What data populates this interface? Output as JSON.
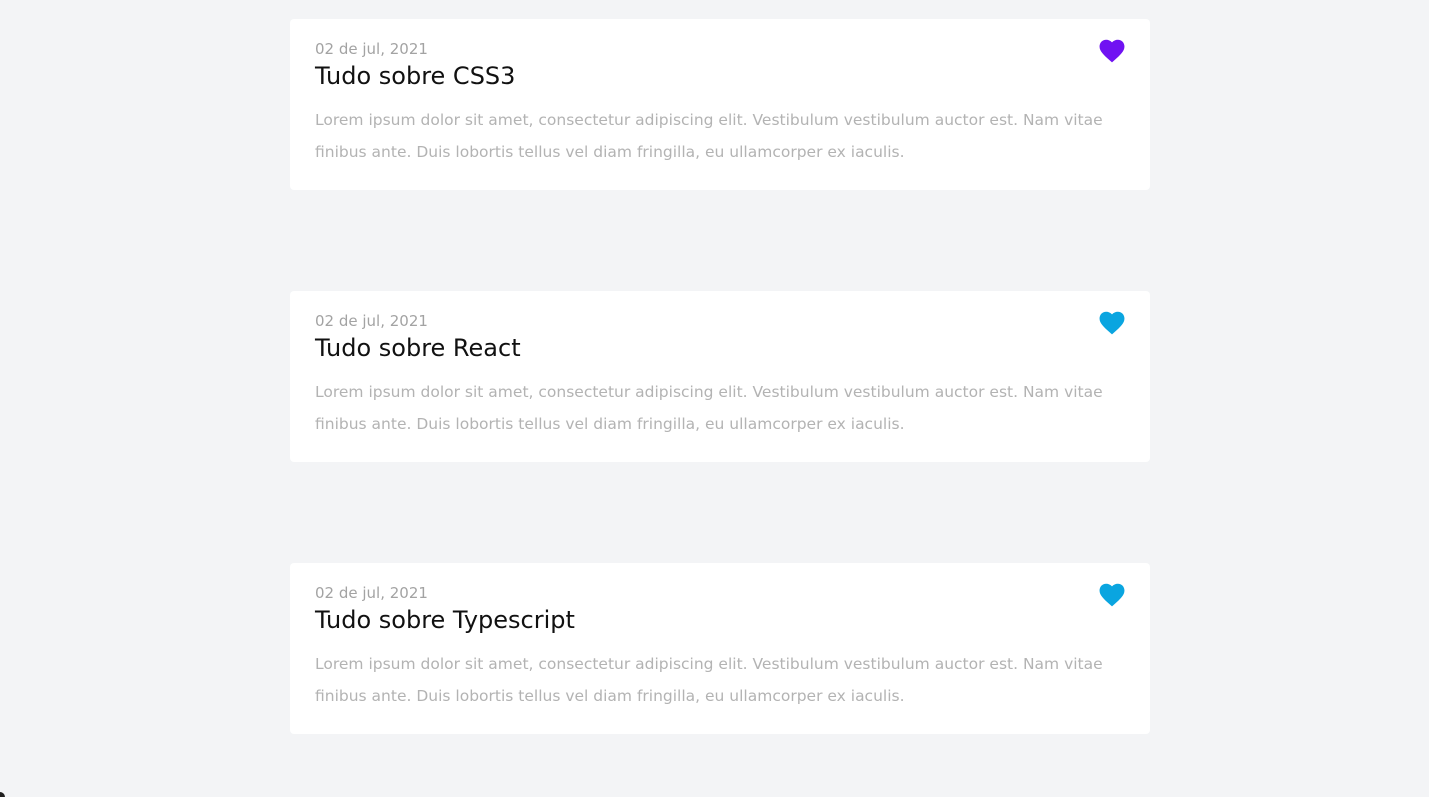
{
  "posts": [
    {
      "date": "02 de jul, 2021",
      "title": "Tudo sobre CSS3",
      "excerpt": "Lorem ipsum dolor sit amet, consectetur adipiscing elit. Vestibulum vestibulum auctor est. Nam vitae finibus ante. Duis lobortis tellus vel diam fringilla, eu ullamcorper ex iaculis.",
      "icon": "heart-icon",
      "favorite_color": "#7012f2"
    },
    {
      "date": "02 de jul, 2021",
      "title": "Tudo sobre React",
      "excerpt": "Lorem ipsum dolor sit amet, consectetur adipiscing elit. Vestibulum vestibulum auctor est. Nam vitae finibus ante. Duis lobortis tellus vel diam fringilla, eu ullamcorper ex iaculis.",
      "icon": "heart-icon",
      "favorite_color": "#0aa5e0"
    },
    {
      "date": "02 de jul, 2021",
      "title": "Tudo sobre Typescript",
      "excerpt": "Lorem ipsum dolor sit amet, consectetur adipiscing elit. Vestibulum vestibulum auctor est. Nam vitae finibus ante. Duis lobortis tellus vel diam fringilla, eu ullamcorper ex iaculis.",
      "icon": "heart-icon",
      "favorite_color": "#0aa5e0"
    }
  ],
  "colors": {
    "background": "#f3f4f6",
    "card": "#ffffff",
    "date_text": "#a3a3a3",
    "title_text": "#111111",
    "excerpt_text": "#b3b3b3"
  }
}
